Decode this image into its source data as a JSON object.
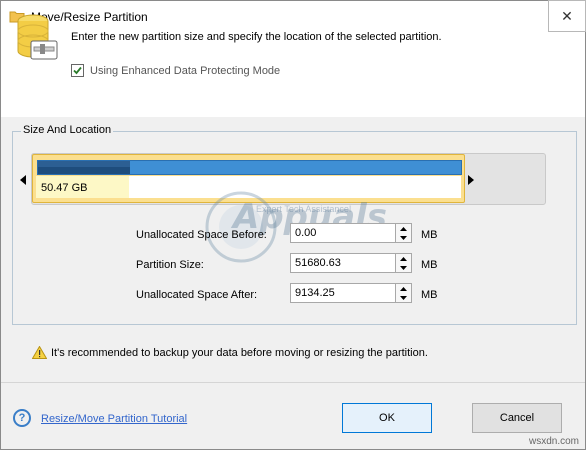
{
  "window": {
    "title": "Move/Resize Partition",
    "close_glyph": "✕"
  },
  "header": {
    "instruction": "Enter the new partition size and specify the location of the selected partition.",
    "checkbox_label": "Using Enhanced Data Protecting Mode",
    "checkbox_checked": true
  },
  "group": {
    "legend": "Size And Location",
    "partition_label": "50.47 GB"
  },
  "fields": [
    {
      "label": "Unallocated Space Before:",
      "value": "0.00",
      "unit": "MB"
    },
    {
      "label": "Partition Size:",
      "value": "51680.63",
      "unit": "MB"
    },
    {
      "label": "Unallocated Space After:",
      "value": "9134.25",
      "unit": "MB"
    }
  ],
  "warning": "It's recommended to backup your data before moving or resizing the partition.",
  "footer": {
    "help_link": "Resize/Move Partition Tutorial",
    "ok_label": "OK",
    "cancel_label": "Cancel"
  },
  "watermark": {
    "brand": "Appuals",
    "tagline": "Expert Tech Assistance!",
    "site": "wsxdn.com"
  },
  "colors": {
    "partition_bar": "#3f8fd4",
    "partition_box": "#fbdf8f",
    "link": "#3366cc",
    "accent": "#0078d7"
  }
}
